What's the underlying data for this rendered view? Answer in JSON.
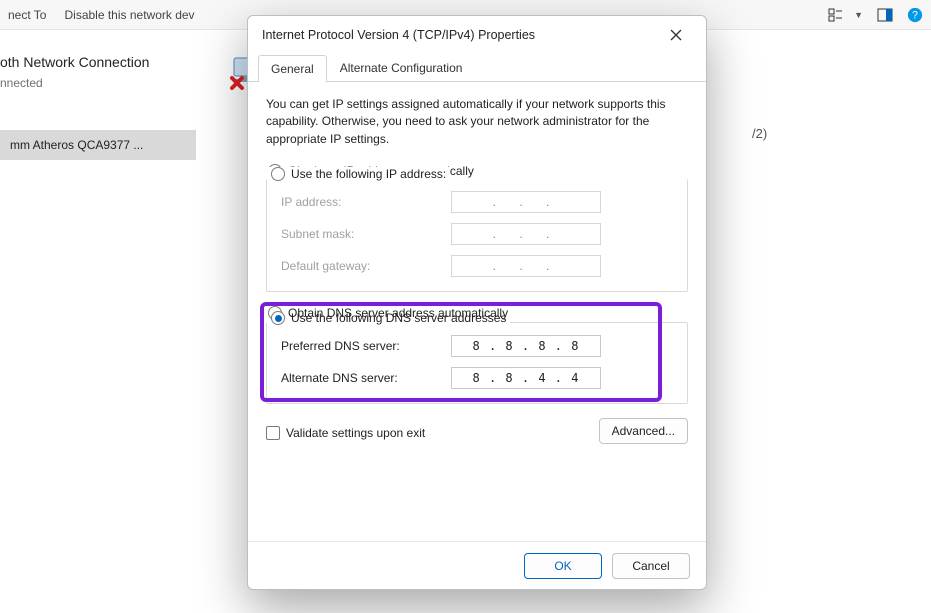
{
  "toolbar": {
    "connect_to": "nect To",
    "disable": "Disable this network dev",
    "view_icon": "view-options-icon",
    "pane_icon": "preview-pane-icon",
    "help_icon": "help-icon"
  },
  "background": {
    "net1_title": "oth Network Connection",
    "net1_sub": "nnected",
    "net2_selected": "mm Atheros QCA9377 ...",
    "right_fragment": "/2)"
  },
  "dialog": {
    "title": "Internet Protocol Version 4 (TCP/IPv4) Properties",
    "tabs": {
      "general": "General",
      "alt": "Alternate Configuration"
    },
    "intro": "You can get IP settings assigned automatically if your network supports this capability. Otherwise, you need to ask your network administrator for the appropriate IP settings.",
    "ip": {
      "auto": "Obtain an IP address automatically",
      "manual": "Use the following IP address:",
      "addr_label": "IP address:",
      "mask_label": "Subnet mask:",
      "gw_label": "Default gateway:",
      "empty": ".       .       ."
    },
    "dns": {
      "auto": "Obtain DNS server address automatically",
      "manual": "Use the following DNS server addresses",
      "pref_label": "Preferred DNS server:",
      "alt_label": "Alternate DNS server:",
      "pref_value": "8 . 8 . 8 . 8",
      "alt_value": "8 . 8 . 4 . 4"
    },
    "validate": "Validate settings upon exit",
    "advanced": "Advanced...",
    "ok": "OK",
    "cancel": "Cancel"
  }
}
